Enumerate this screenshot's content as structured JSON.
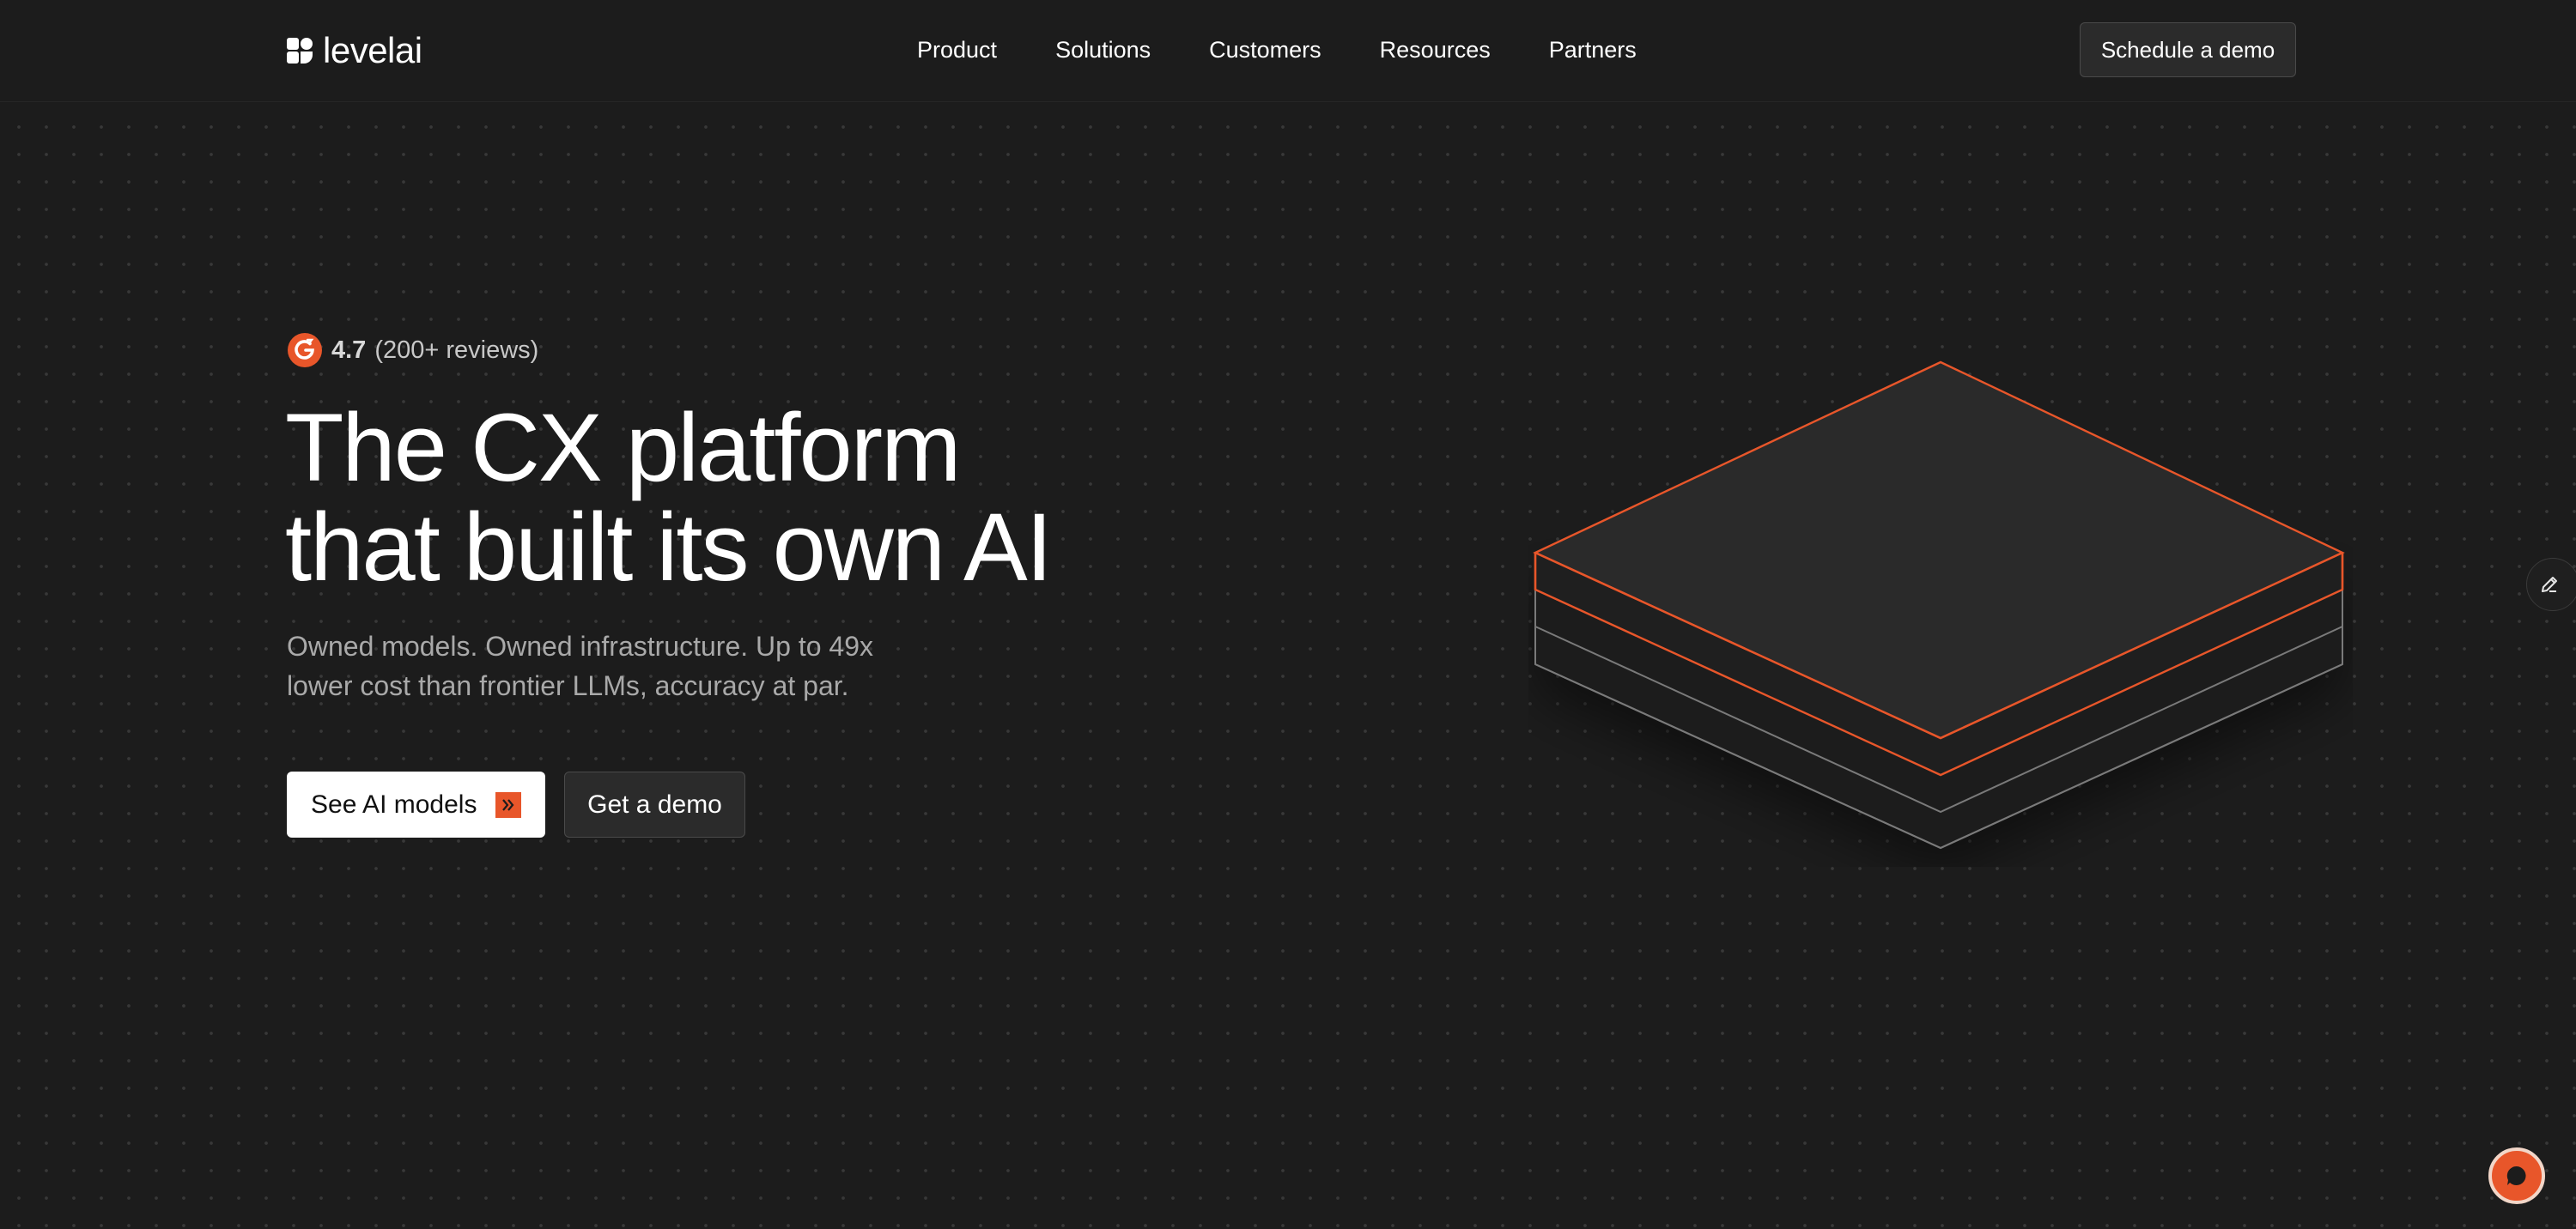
{
  "brand": {
    "name": "levelai",
    "accent": "#e8562a"
  },
  "nav": {
    "items": [
      {
        "label": "Product"
      },
      {
        "label": "Solutions"
      },
      {
        "label": "Customers"
      },
      {
        "label": "Resources"
      },
      {
        "label": "Partners"
      }
    ],
    "cta_label": "Schedule a demo"
  },
  "hero": {
    "rating_icon": "g2-icon",
    "rating_score": "4.7",
    "rating_count": "(200+ reviews)",
    "headline_line1": "The CX platform",
    "headline_line2": "that built its own AI",
    "subhead_line1": "Owned models. Owned infrastructure. Up to 49x",
    "subhead_line2": "lower cost than frontier LLMs, accuracy at par.",
    "primary_cta": "See AI models",
    "secondary_cta": "Get a demo"
  },
  "widgets": {
    "edit_icon": "pencil-icon",
    "chat_icon": "chat-bubble-icon"
  }
}
